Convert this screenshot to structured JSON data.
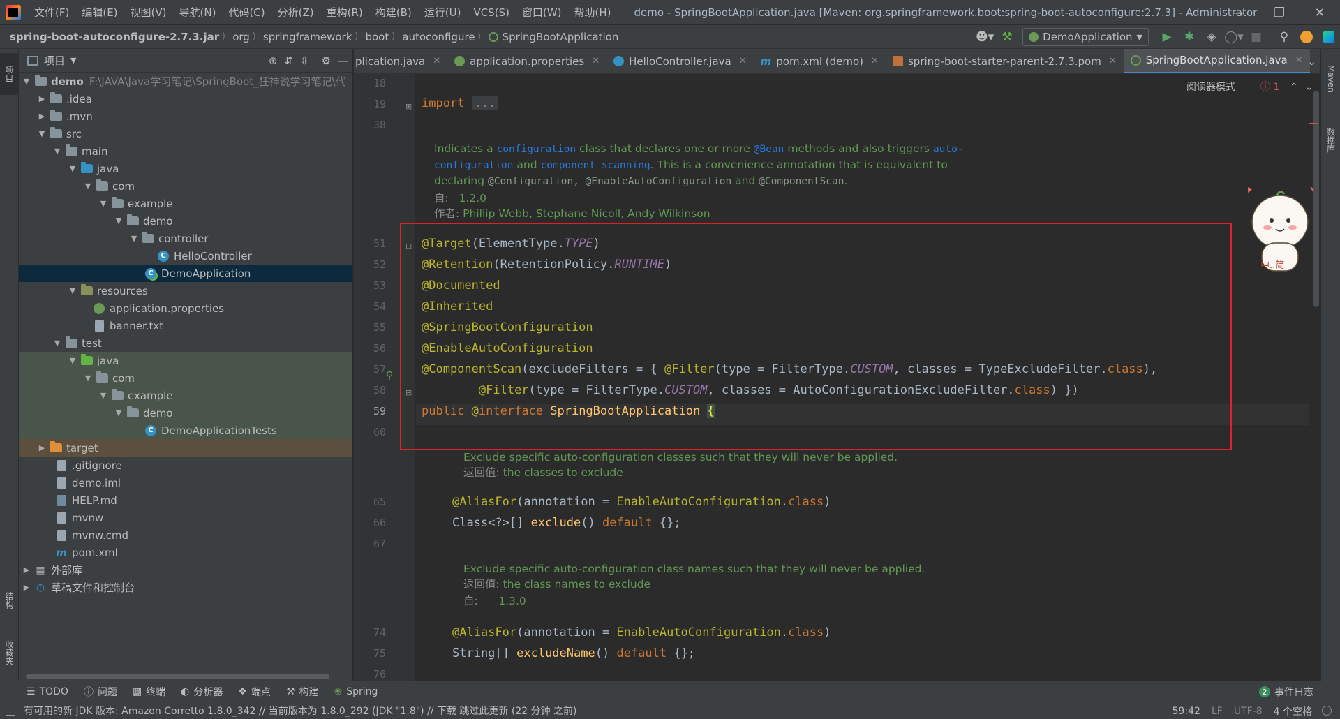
{
  "menubar": {
    "items": [
      "文件(F)",
      "编辑(E)",
      "视图(V)",
      "导航(N)",
      "代码(C)",
      "分析(Z)",
      "重构(R)",
      "构建(B)",
      "运行(U)",
      "VCS(S)",
      "窗口(W)",
      "帮助(H)"
    ],
    "window_title": "demo - SpringBootApplication.java [Maven: org.springframework.boot:spring-boot-autoconfigure:2.7.3] - Administrator"
  },
  "navbar": {
    "breadcrumbs": [
      "spring-boot-autoconfigure-2.7.3.jar",
      "org",
      "springframework",
      "boot",
      "autoconfigure",
      "SpringBootApplication"
    ],
    "run_config": "DemoApplication"
  },
  "left_strip": {
    "project_tab": "项目",
    "structure_tab": "结构",
    "favorites_tab": "收藏夹"
  },
  "right_strip": {
    "maven_tab": "Maven",
    "database_tab": "数据库"
  },
  "project": {
    "title": "项目",
    "root_name": "demo",
    "root_path": "F:\\JAVA\\Java学习笔记\\SpringBoot_狂神说学习笔记\\代",
    "items": [
      ".idea",
      ".mvn",
      "src",
      "main",
      "java",
      "com",
      "example",
      "demo",
      "controller",
      "HelloController",
      "DemoApplication",
      "resources",
      "application.properties",
      "banner.txt",
      "test",
      "java",
      "com",
      "example",
      "demo",
      "DemoApplicationTests",
      "target",
      ".gitignore",
      "demo.iml",
      "HELP.md",
      "mvnw",
      "mvnw.cmd",
      "pom.xml",
      "外部库",
      "草稿文件和控制台"
    ]
  },
  "tabs": [
    {
      "label": "plication.java"
    },
    {
      "label": "application.properties"
    },
    {
      "label": "HelloController.java"
    },
    {
      "label": "pom.xml (demo)"
    },
    {
      "label": "spring-boot-starter-parent-2.7.3.pom"
    },
    {
      "label": "SpringBootApplication.java"
    }
  ],
  "editor": {
    "reader_mode": "阅读器模式",
    "error_count": "1",
    "line_numbers": [
      "18",
      "19",
      "38",
      "51",
      "52",
      "53",
      "54",
      "55",
      "56",
      "57",
      "58",
      "59",
      "60",
      "65",
      "66",
      "67",
      "74",
      "75",
      "76"
    ],
    "import_kw": "import",
    "import_dots": "...",
    "doc1": {
      "l1_a": "Indicates a ",
      "l1_link1": "configuration",
      "l1_b": " class that declares one or more ",
      "l1_link2": "@Bean",
      "l1_c": " methods and also triggers ",
      "l1_link3": "auto-",
      "l2_link1": "configuration",
      "l2_a": " and ",
      "l2_link2": "component scanning",
      "l2_b": ". This is a convenience annotation that is equivalent to",
      "l3_a": "declaring ",
      "l3_code": "@Configuration, @EnableAutoConfiguration",
      "l3_b": " and ",
      "l3_code2": "@ComponentScan",
      "l3_c": ".",
      "since_label": "自:",
      "since_value": "1.2.0",
      "author_label": "作者:",
      "author_value": "Phillip Webb, Stephane Nicoll, Andy Wilkinson"
    },
    "code": {
      "l51_ann": "@Target",
      "l51_a": "(ElementType.",
      "l51_cst": "TYPE",
      "l51_b": ")",
      "l52_ann": "@Retention",
      "l52_a": "(RetentionPolicy.",
      "l52_cst": "RUNTIME",
      "l52_b": ")",
      "l53_ann": "@Documented",
      "l54_ann": "@Inherited",
      "l55_ann": "@SpringBootConfiguration",
      "l56_ann": "@EnableAutoConfiguration",
      "l57_ann": "@ComponentScan",
      "l57_a": "(excludeFilters = { ",
      "l57_ann2": "@Filter",
      "l57_b": "(type = FilterType.",
      "l57_cst": "CUSTOM",
      "l57_c": ", classes = TypeExcludeFilter.",
      "l57_kw": "class",
      "l57_d": "),",
      "l58_indent": "        ",
      "l58_ann": "@Filter",
      "l58_a": "(type = FilterType.",
      "l58_cst": "CUSTOM",
      "l58_b": ", classes = AutoConfigurationExcludeFilter.",
      "l58_kw": "class",
      "l58_c": ") })",
      "l59_kw": "public",
      "l59_a": " @",
      "l59_kw2": "interface",
      "l59_name": " SpringBootApplication ",
      "l59_brace": "{",
      "l65_ann": "@AliasFor",
      "l65_a": "(annotation = ",
      "l65_ann2": "EnableAutoConfiguration",
      "l65_b": ".",
      "l65_kw": "class",
      "l65_c": ")",
      "l66_a": "Class<?>[] ",
      "l66_m": "exclude",
      "l66_b": "() ",
      "l66_kw": "default",
      "l66_c": " {};",
      "l74_ann": "@AliasFor",
      "l74_a": "(annotation = ",
      "l74_ann2": "EnableAutoConfiguration",
      "l74_b": ".",
      "l74_kw": "class",
      "l74_c": ")",
      "l75_a": "String[] ",
      "l75_m": "excludeName",
      "l75_b": "() ",
      "l75_kw": "default",
      "l75_c": " {};"
    },
    "doc2": {
      "l1": "Exclude specific auto-configuration classes such that they will never be applied.",
      "ret_label": "返回值:",
      "ret_value": "the classes to exclude"
    },
    "doc3": {
      "l1": "Exclude specific auto-configuration class names such that they will never be applied.",
      "ret_label": "返回值:",
      "ret_value": "the class names to exclude",
      "since_label": "自:",
      "since_value": "1.3.0"
    }
  },
  "bottom_tools": [
    "TODO",
    "问题",
    "终端",
    "分析器",
    "端点",
    "构建",
    "Spring"
  ],
  "event_log": {
    "count": "2",
    "label": "事件日志"
  },
  "status": {
    "message": "有可用的新 JDK 版本: Amazon Corretto 1.8.0_342 // 当前版本为 1.8.0_292 (JDK \"1.8\") // 下载   跳过此更新 (22 分钟 之前)",
    "position": "59:42",
    "line_sep": "LF",
    "encoding": "UTF-8",
    "indent": "4 个空格"
  },
  "mascot_caption": "中..简"
}
